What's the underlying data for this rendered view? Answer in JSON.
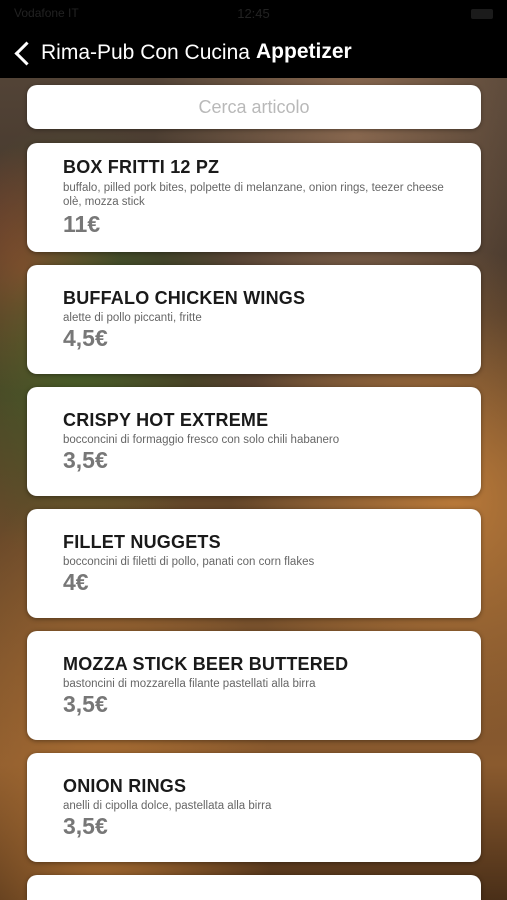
{
  "status": {
    "carrier": "Vodafone IT",
    "time": "12:45"
  },
  "nav": {
    "back_label": "Rima-Pub Con Cucina",
    "title": "Appetizer"
  },
  "search": {
    "placeholder": "Cerca articolo"
  },
  "items": [
    {
      "name": "BOX FRITTI 12 PZ",
      "description": "buffalo, pilled pork bites, polpette di melanzane, onion rings, teezer cheese olè, mozza stick",
      "price": "11€"
    },
    {
      "name": "BUFFALO CHICKEN WINGS",
      "description": "alette di pollo piccanti, fritte",
      "price": "4,5€"
    },
    {
      "name": "CRISPY HOT EXTREME",
      "description": "bocconcini di formaggio fresco con solo chili habanero",
      "price": "3,5€"
    },
    {
      "name": "FILLET NUGGETS",
      "description": "bocconcini di filetti di pollo, panati con corn flakes",
      "price": "4€"
    },
    {
      "name": "MOZZA STICK BEER BUTTERED",
      "description": "bastoncini di mozzarella filante pastellati alla birra",
      "price": "3,5€"
    },
    {
      "name": "ONION RINGS",
      "description": "anelli di cipolla dolce, pastellata alla birra",
      "price": "3,5€"
    }
  ]
}
